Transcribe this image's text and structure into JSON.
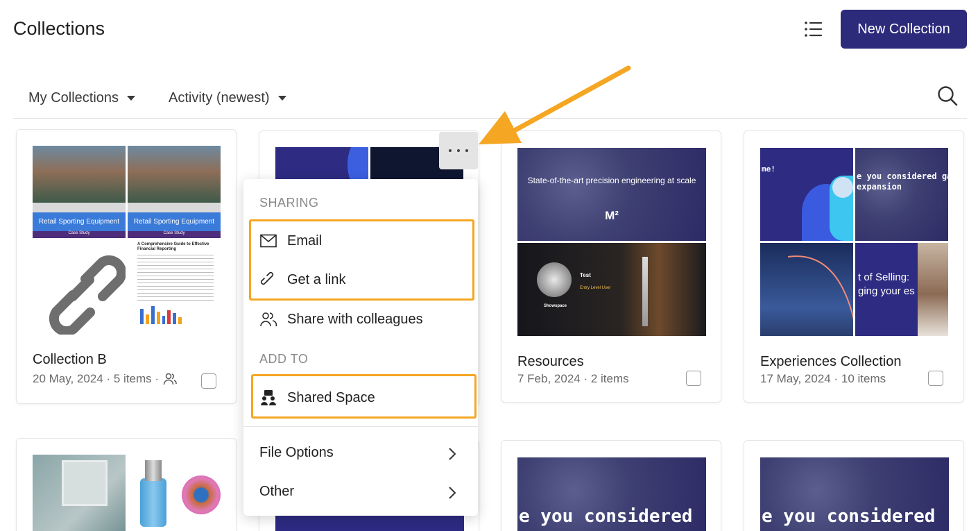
{
  "header": {
    "title": "Collections",
    "new_collection_label": "New Collection"
  },
  "filters": {
    "owner": "My Collections",
    "sort": "Activity (newest)"
  },
  "cards": {
    "collection_b": {
      "title": "Collection B",
      "meta": "20 May, 2024 · 5 items ·",
      "banner": "Retail Sporting Equipment",
      "banner_sub": "Case Study",
      "doc_title": "A Comprehensive Guide to Effective Financial Reporting"
    },
    "resources": {
      "title": "Resources",
      "meta": "7 Feb, 2024 · 2 items",
      "slide_heading": "State-of-the-art precision engineering at scale",
      "slide_logo": "M²",
      "profile_name": "Test",
      "profile_role": "Entry Level User",
      "profile_company": "Showspace"
    },
    "experiences": {
      "title": "Experiences Collection",
      "meta": "17 May, 2024 · 10 items",
      "slide_a": "me!",
      "slide_b": "e you considered galactic expansion",
      "slide_c": "t of Selling: ging your es"
    },
    "row2": {
      "slide_text": "e you considered"
    }
  },
  "menu": {
    "sharing_header": "SHARING",
    "email": "Email",
    "get_link": "Get a link",
    "share_colleagues": "Share with colleagues",
    "add_to_header": "ADD TO",
    "shared_space": "Shared Space",
    "file_options": "File Options",
    "other": "Other"
  },
  "colors": {
    "primary": "#2c2a7a",
    "highlight": "#f5a623",
    "slide_navy": "#2d2b82"
  }
}
